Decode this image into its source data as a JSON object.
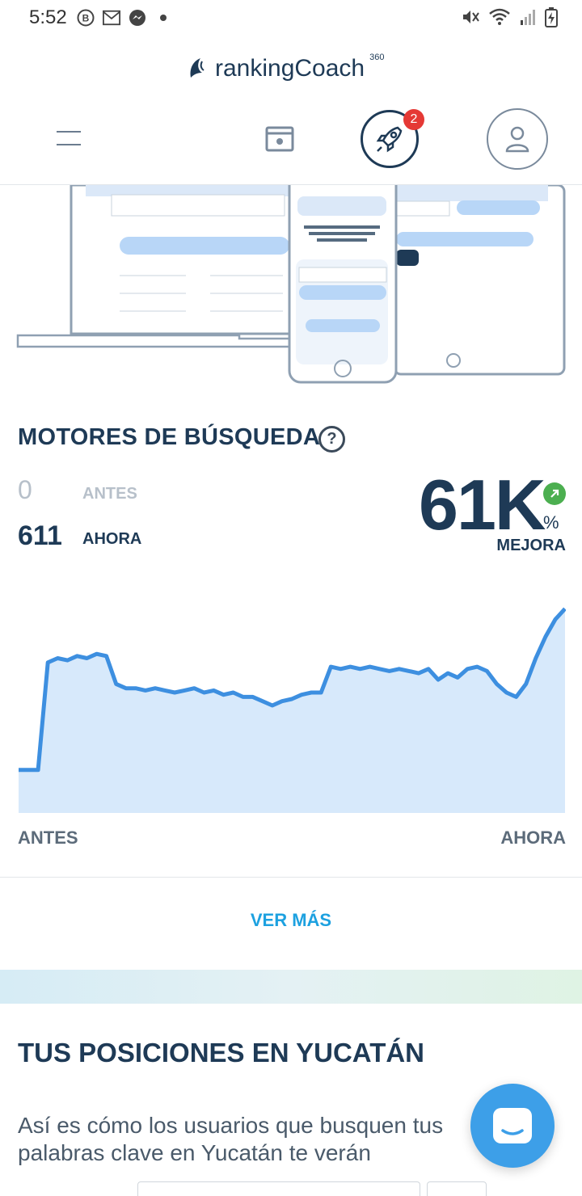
{
  "status_bar": {
    "time": "5:52",
    "icons": [
      "b-icon",
      "gmail-icon",
      "messenger-icon",
      "dot-icon",
      "mute-icon",
      "wifi-icon",
      "signal-icon",
      "battery-icon"
    ]
  },
  "header": {
    "brand": "rankingCoach",
    "brand_sup": "360",
    "notification_count": "2"
  },
  "search_engines": {
    "title": "MOTORES DE BÚSQUEDA",
    "before_value": "0",
    "before_label": "ANTES",
    "now_value": "611",
    "now_label": "AHORA",
    "improvement": "61K",
    "improvement_unit": "%",
    "improvement_label": "MEJORA",
    "axis_start": "ANTES",
    "axis_end": "AHORA",
    "more_link": "VER MÁS"
  },
  "chart_data": {
    "type": "area",
    "title": "",
    "xlabel": "",
    "ylabel": "",
    "x_labels": [
      "ANTES",
      "AHORA"
    ],
    "values": [
      20,
      20,
      20,
      70,
      72,
      71,
      73,
      72,
      74,
      73,
      60,
      58,
      58,
      57,
      58,
      57,
      56,
      57,
      58,
      56,
      57,
      55,
      56,
      54,
      54,
      52,
      50,
      52,
      53,
      55,
      56,
      56,
      68,
      67,
      68,
      67,
      68,
      67,
      66,
      67,
      66,
      65,
      67,
      62,
      65,
      63,
      67,
      68,
      66,
      60,
      56,
      54,
      60,
      72,
      82,
      90,
      95
    ],
    "ylim": [
      0,
      100
    ],
    "colors": {
      "line": "#3d8fe0",
      "fill": "#d7e9fb"
    }
  },
  "positions": {
    "title": "TUS POSICIONES EN YUCATÁN",
    "description": "Así es cómo los usuarios que busquen tus palabras clave en Yucatán te verán"
  },
  "colors": {
    "primary": "#1e3a56",
    "accent": "#1da1e0",
    "badge": "#e53935",
    "success": "#4caf50",
    "chat": "#3d9fe8"
  }
}
